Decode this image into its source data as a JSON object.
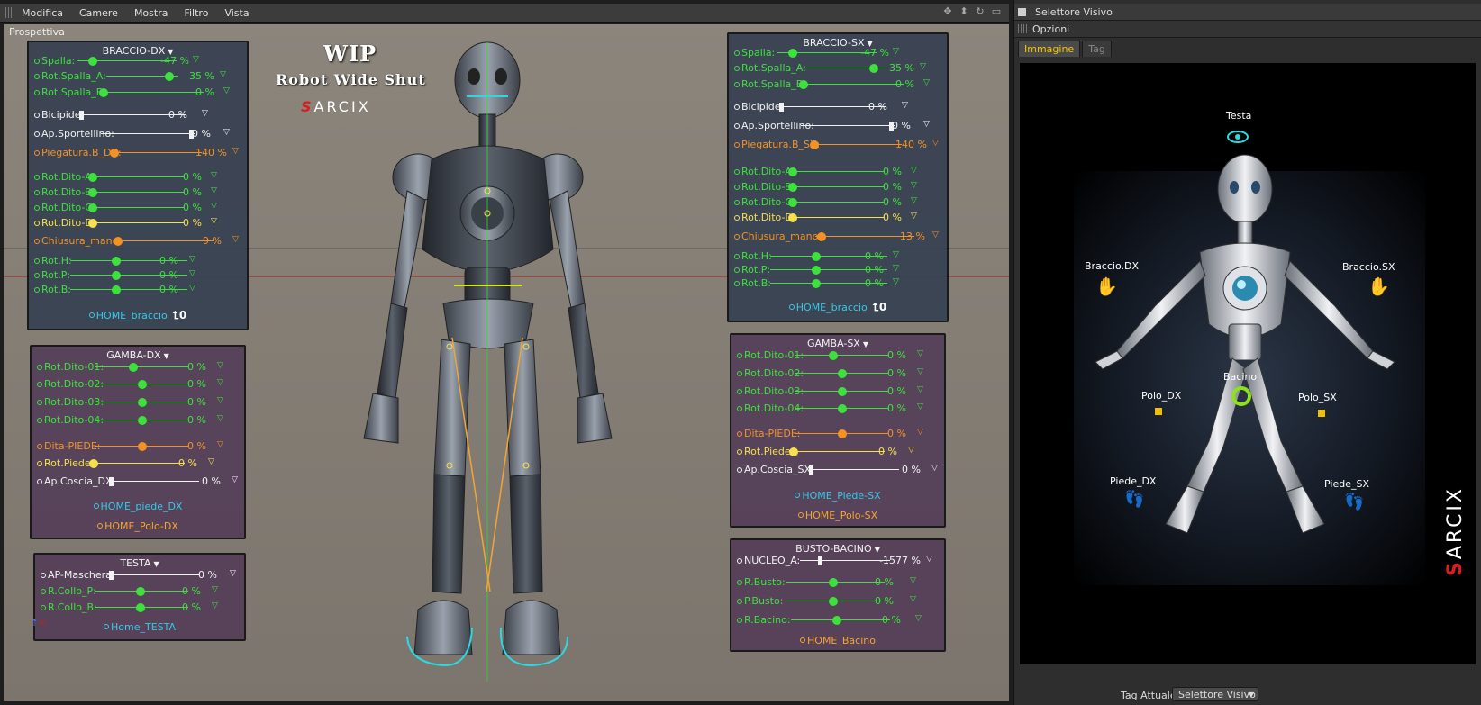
{
  "viewport": {
    "menus": [
      "Modifica",
      "Camere",
      "Mostra",
      "Filtro",
      "Vista"
    ],
    "view_name": "Prospettiva",
    "title": "WIP",
    "subtitle": "Robot Wide Shut",
    "logo": "ARCIX",
    "logo_initial": "S"
  },
  "panels": {
    "braccio_dx": {
      "title": "BRACCIO-DX",
      "rows": [
        {
          "label": "Spalla:",
          "value": "-47 %"
        },
        {
          "label": "Rot.Spalla_A:",
          "value": "35 %"
        },
        {
          "label": "Rot.Spalla_B:",
          "value": "0 %"
        },
        {
          "label": "Bicipide:",
          "value": "0 %"
        },
        {
          "label": "Ap.Sportellino:",
          "value": "0 %"
        },
        {
          "label": "Piegatura.B_DX:",
          "value": "140 %"
        },
        {
          "label": "Rot.Dito-A:",
          "value": "0 %"
        },
        {
          "label": "Rot.Dito-B:",
          "value": "0 %"
        },
        {
          "label": "Rot.Dito-C:",
          "value": "0 %"
        },
        {
          "label": "Rot.Dito-D:",
          "value": "0 %"
        },
        {
          "label": "Chiusura_mano:",
          "value": "9 %"
        },
        {
          "label": "Rot.H:",
          "value": "0 %"
        },
        {
          "label": "Rot.P:",
          "value": "0 %"
        },
        {
          "label": "Rot.B:",
          "value": "0 %"
        }
      ],
      "home": "HOME_braccio",
      "home_icon": "0"
    },
    "braccio_sx": {
      "title": "BRACCIO-SX",
      "rows": [
        {
          "label": "Spalla:",
          "value": "-47 %"
        },
        {
          "label": "Rot.Spalla_A:",
          "value": "35 %"
        },
        {
          "label": "Rot.Spalla_B:",
          "value": "0 %"
        },
        {
          "label": "Bicipide:",
          "value": "0 %"
        },
        {
          "label": "Ap.Sportellino:",
          "value": "0 %"
        },
        {
          "label": "Piegatura.B_SX:",
          "value": "140 %"
        },
        {
          "label": "Rot.Dito-A:",
          "value": "0 %"
        },
        {
          "label": "Rot.Dito-B:",
          "value": "0 %"
        },
        {
          "label": "Rot.Dito-C:",
          "value": "0 %"
        },
        {
          "label": "Rot.Dito-D:",
          "value": "0 %"
        },
        {
          "label": "Chiusura_mano:",
          "value": "13 %"
        },
        {
          "label": "Rot.H:",
          "value": "0 %"
        },
        {
          "label": "Rot.P:",
          "value": "0 %"
        },
        {
          "label": "Rot.B:",
          "value": "0 %"
        }
      ],
      "home": "HOME_braccio",
      "home_icon": "0"
    },
    "gamba_dx": {
      "title": "GAMBA-DX",
      "rows": [
        {
          "label": "Rot.Dito-01:",
          "value": "0 %"
        },
        {
          "label": "Rot.Dito-02:",
          "value": "0 %"
        },
        {
          "label": "Rot.Dito-03:",
          "value": "0 %"
        },
        {
          "label": "Rot.Dito-04:",
          "value": "0 %"
        },
        {
          "label": "Dita-PIEDE:",
          "value": "0 %"
        },
        {
          "label": "Rot.Piede:",
          "value": "0 %"
        },
        {
          "label": "Ap.Coscia_DX:",
          "value": "0 %"
        }
      ],
      "home1": "HOME_piede_DX",
      "home2": "HOME_Polo-DX"
    },
    "gamba_sx": {
      "title": "GAMBA-SX",
      "rows": [
        {
          "label": "Rot.Dito-01:",
          "value": "0 %"
        },
        {
          "label": "Rot.Dito-02:",
          "value": "0 %"
        },
        {
          "label": "Rot.Dito-03:",
          "value": "0 %"
        },
        {
          "label": "Rot.Dito-04:",
          "value": "0 %"
        },
        {
          "label": "Dita-PIEDE:",
          "value": "0 %"
        },
        {
          "label": "Rot.Piede:",
          "value": "0 %"
        },
        {
          "label": "Ap.Coscia_SX:",
          "value": "0 %"
        }
      ],
      "home1": "HOME_Piede-SX",
      "home2": "HOME_Polo-SX"
    },
    "testa": {
      "title": "TESTA",
      "rows": [
        {
          "label": "AP-Maschera:",
          "value": "0 %"
        },
        {
          "label": "R.Collo_P:",
          "value": "0 %"
        },
        {
          "label": "R.Collo_B:",
          "value": "0 %"
        }
      ],
      "home": "Home_TESTA"
    },
    "busto_bacino": {
      "title": "BUSTO-BACINO",
      "rows": [
        {
          "label": "NUCLEO_A:",
          "value": "-1577 %"
        },
        {
          "label": "R.Busto:",
          "value": "0 %"
        },
        {
          "label": "P.Busto:",
          "value": "0 %"
        },
        {
          "label": "R.Bacino:",
          "value": "0 %"
        }
      ],
      "home": "HOME_Bacino"
    }
  },
  "selector": {
    "header": "Selettore Visivo",
    "options": "Opzioni",
    "tabs": [
      "Immagine",
      "Tag"
    ],
    "labels": {
      "testa": "Testa",
      "braccio_dx": "Braccio.DX",
      "braccio_sx": "Braccio.SX",
      "bacino": "Bacino",
      "polo_dx": "Polo_DX",
      "polo_sx": "Polo_SX",
      "piede_dx": "Piede_DX",
      "piede_sx": "Piede_SX"
    },
    "logo": "ARCIX",
    "logo_initial": "S",
    "footer_label": "Tag Attuale",
    "footer_select": "Selettore Visivo"
  },
  "colors": {
    "green": "#3ee03e",
    "orange": "#f39223",
    "yellow": "#f6e04d",
    "cyan": "#38c8e8",
    "tab_active": "#f5c400"
  }
}
